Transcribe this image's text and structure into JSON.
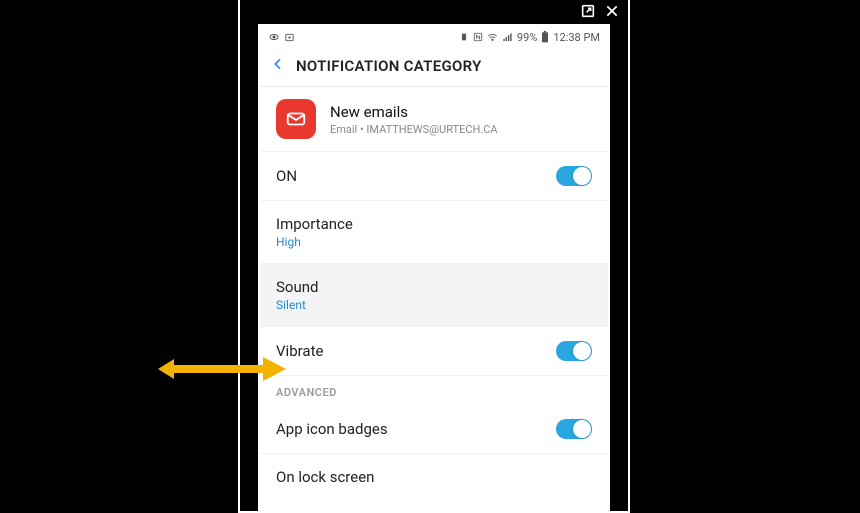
{
  "status": {
    "battery_text": "99%",
    "time": "12:38 PM"
  },
  "header": {
    "title": "NOTIFICATION CATEGORY"
  },
  "app": {
    "title": "New emails",
    "subtitle": "Email • IMATTHEWS@URTECH.CA"
  },
  "rows": {
    "on_label": "ON",
    "importance_label": "Importance",
    "importance_value": "High",
    "sound_label": "Sound",
    "sound_value": "Silent",
    "vibrate_label": "Vibrate",
    "advanced_header": "ADVANCED",
    "badges_label": "App icon badges",
    "lock_label": "On lock screen"
  },
  "toggles": {
    "on": true,
    "vibrate": true,
    "badges": true
  }
}
